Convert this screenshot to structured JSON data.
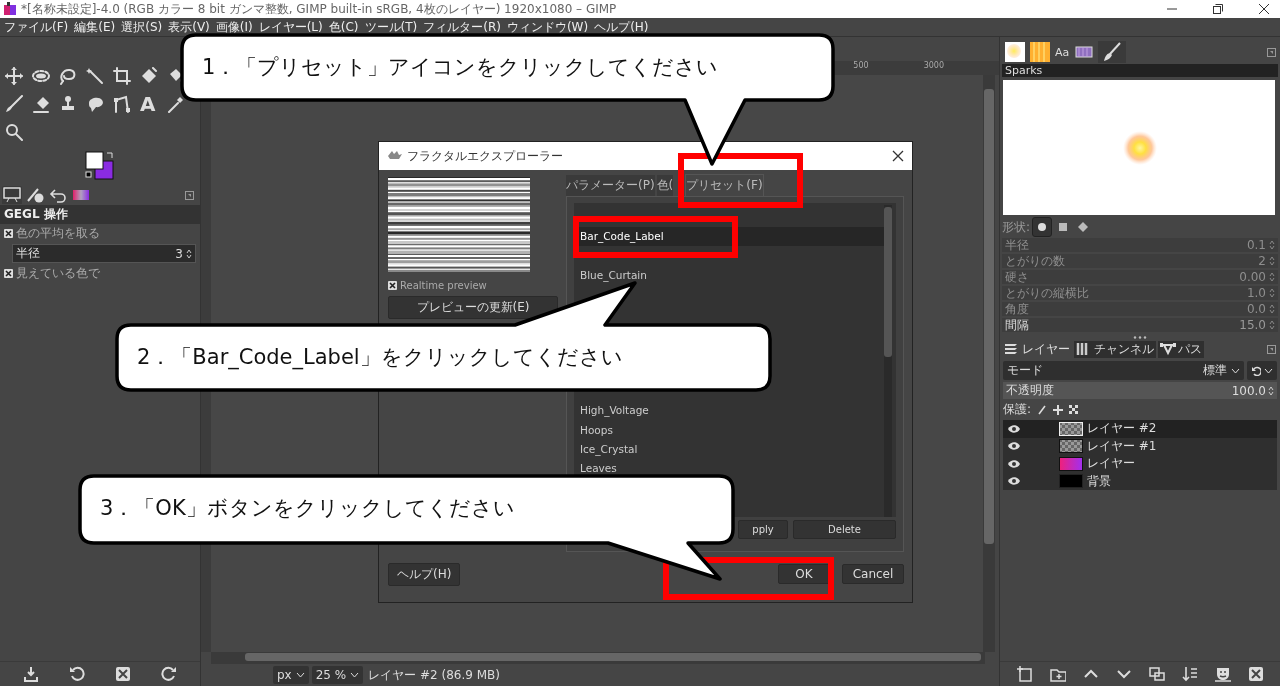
{
  "window": {
    "title": "*[名称未設定]-4.0 (RGB カラー 8 bit ガンマ整数, GIMP built-in sRGB, 4枚のレイヤー) 1920x1080 – GIMP"
  },
  "menu": [
    "ファイル(F)",
    "編集(E)",
    "選択(S)",
    "表示(V)",
    "画像(I)",
    "レイヤー(L)",
    "色(C)",
    "ツール(T)",
    "フィルター(R)",
    "ウィンドウ(W)",
    "ヘルプ(H)"
  ],
  "toolbox": {
    "text_tool_glyph": "A"
  },
  "tool_options": {
    "title": "GEGL 操作",
    "options": [
      {
        "kind": "checkbox",
        "label": "色の平均を取る",
        "checked": true
      },
      {
        "kind": "spin",
        "label": "半径",
        "value": "3"
      },
      {
        "kind": "checkbox",
        "label": "見えている色で",
        "checked": true
      }
    ]
  },
  "ruler": {
    "labels": [
      "500",
      "3000"
    ]
  },
  "dialog": {
    "title": "フラクタルエクスプローラー",
    "realtime_preview": {
      "label": "Realtime preview",
      "checked": true
    },
    "update_button": "プレビューの更新(E)",
    "tabs": [
      {
        "label": "パラメーター(P)",
        "selected": false
      },
      {
        "label": "色(",
        "selected": false
      },
      {
        "label": "プリセット(F)",
        "selected": true
      }
    ],
    "presets": [
      [
        {
          "label": "Bar_Code_Label",
          "selected": true
        }
      ],
      [
        {
          "label": "Blue_Curtain",
          "selected": false
        }
      ],
      [
        {
          "label": "High_Voltage",
          "selected": false
        },
        {
          "label": "Hoops",
          "selected": false
        },
        {
          "label": "Ice_Crystal",
          "selected": false
        },
        {
          "label": "Leaves",
          "selected": false
        }
      ]
    ],
    "list_buttons": [
      "pply",
      "Delete"
    ],
    "help_button": "ヘルプ(H)",
    "ok_button": "OK",
    "cancel_button": "Cancel"
  },
  "brushes": {
    "tabs": [
      {
        "kind": "brush",
        "selected": false
      },
      {
        "kind": "pattern",
        "selected": false
      },
      {
        "kind": "font",
        "glyph": "Aa",
        "selected": false
      },
      {
        "kind": "gradient",
        "selected": false
      },
      {
        "kind": "paintbrush",
        "selected": true
      }
    ],
    "name": "Sparks",
    "shape_label": "形状:",
    "shapes": [
      {
        "kind": "circle",
        "selected": true
      },
      {
        "kind": "square",
        "selected": false
      },
      {
        "kind": "diamond",
        "selected": false
      }
    ],
    "params": [
      {
        "label": "半径",
        "value": "0.1",
        "disabled": true
      },
      {
        "label": "とがりの数",
        "value": "2",
        "disabled": true
      },
      {
        "label": "硬さ",
        "value": "0.00",
        "disabled": true
      },
      {
        "label": "とがりの縦横比",
        "value": "1.0",
        "disabled": true
      },
      {
        "label": "角度",
        "value": "0.0",
        "disabled": true
      },
      {
        "label": "間隔",
        "value": "15.0",
        "disabled": false
      }
    ]
  },
  "layers": {
    "tabs": [
      {
        "label": "レイヤー",
        "kind": "layers",
        "selected": true
      },
      {
        "label": "チャンネル",
        "kind": "channels",
        "selected": false
      },
      {
        "label": "パス",
        "kind": "paths",
        "selected": false
      }
    ],
    "mode_label": "モード",
    "mode_value": "標準",
    "opacity_label": "不透明度",
    "opacity_value": "100.0",
    "lock_label": "保護:",
    "items": [
      {
        "name": "レイヤー #2",
        "kind": "transparent",
        "visible": true,
        "selected": true
      },
      {
        "name": "レイヤー #1",
        "kind": "transparent",
        "visible": true,
        "selected": false
      },
      {
        "name": "レイヤー",
        "kind": "gradient",
        "visible": true,
        "selected": false
      },
      {
        "name": "背景",
        "kind": "black",
        "visible": true,
        "selected": false
      }
    ]
  },
  "status": {
    "unit": "px",
    "zoom": "25 %",
    "info": "レイヤー #2 (86.9 MB)"
  },
  "callouts": [
    {
      "text": "1．「プリセット」アイコンをクリックしてください"
    },
    {
      "text": "2．「Bar_Code_Label」をクリックしてください"
    },
    {
      "text": "3．「OK」ボタンをクリックしてください"
    }
  ]
}
